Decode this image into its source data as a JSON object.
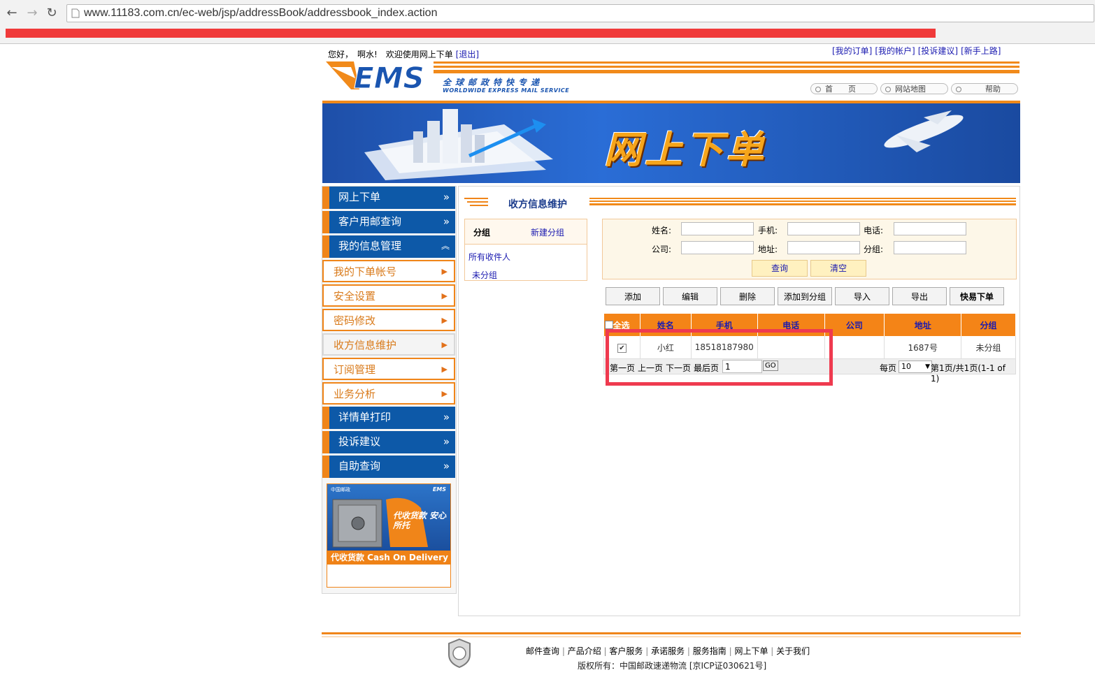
{
  "browser": {
    "url": "www.11183.com.cn/ec-web/jsp/addressBook/addressbook_index.action"
  },
  "header": {
    "greeting": "您好，　啊水!　欢迎使用网上下单",
    "logout": "[退出]",
    "top_links": [
      "[我的订单]",
      "[我的帐户]",
      "[投诉建议]",
      "[新手上路]"
    ],
    "logo_text": "EMS",
    "tagline_cn": "全球邮政特快专递",
    "tagline_en": "WORLDWIDE EXPRESS MAIL SERVICE",
    "nav_pills": [
      "首　　页",
      "网站地图",
      "帮助"
    ]
  },
  "banner": {
    "title": "网上下单"
  },
  "sidebar": {
    "items": [
      {
        "label": "网上下单",
        "style": "blue",
        "arrow": "»"
      },
      {
        "label": "客户用邮查询",
        "style": "blue",
        "arrow": "»"
      },
      {
        "label": "我的信息管理",
        "style": "blue",
        "arrow": "︽"
      },
      {
        "label": "我的下单帐号",
        "style": "white",
        "arrow": "▶"
      },
      {
        "label": "安全设置",
        "style": "white",
        "arrow": "▶"
      },
      {
        "label": "密码修改",
        "style": "white",
        "arrow": "▶"
      },
      {
        "label": "收方信息维护",
        "style": "active",
        "arrow": "▶"
      },
      {
        "label": "订阅管理",
        "style": "white",
        "arrow": "▶"
      },
      {
        "label": "业务分析",
        "style": "white",
        "arrow": "▶"
      },
      {
        "label": "详情单打印",
        "style": "blue",
        "arrow": "»"
      },
      {
        "label": "投诉建议",
        "style": "blue",
        "arrow": "»"
      },
      {
        "label": "自助查询",
        "style": "blue",
        "arrow": "»"
      }
    ],
    "ad": {
      "text": "代收货款 Cash On Delivery",
      "slogan": "代收货款 安心所托",
      "brand": "中国邮政",
      "brand_ems": "EMS"
    }
  },
  "main": {
    "title": "收方信息维护",
    "groups": {
      "header": "分组",
      "new_group": "新建分组",
      "items": [
        "所有收件人",
        "未分组"
      ]
    },
    "search": {
      "name_label": "姓名:",
      "mobile_label": "手机:",
      "phone_label": "电话:",
      "company_label": "公司:",
      "address_label": "地址:",
      "group_label": "分组:",
      "name_value": "",
      "mobile_value": "",
      "phone_value": "",
      "company_value": "",
      "address_value": "",
      "group_value": "",
      "query_button": "查询",
      "clear_button": "清空"
    },
    "toolbar": [
      "添加",
      "编辑",
      "删除",
      "添加到分组",
      "导入",
      "导出",
      "快易下单"
    ],
    "table": {
      "select_all": "全选",
      "columns": [
        "姓名",
        "手机",
        "电话",
        "公司",
        "地址",
        "分组"
      ],
      "rows": [
        {
          "checked": true,
          "name": "小红",
          "mobile": "18518187980",
          "phone": "",
          "company": "",
          "address": "1687号",
          "group": "未分组"
        }
      ]
    },
    "pager": {
      "first": "第一页",
      "prev": "上一页",
      "next": "下一页",
      "last": "最后页",
      "page_input": "1",
      "go": "GO",
      "per_page_label": "每页",
      "per_page_value": "10",
      "summary": "第1页/共1页(1-1 of 1)"
    }
  },
  "footer": {
    "links": [
      "邮件查询",
      "产品介绍",
      "客户服务",
      "承诺服务",
      "服务指南",
      "网上下单",
      "关于我们"
    ],
    "copyright": "版权所有：中国邮政速递物流 [京ICP证030621号]"
  },
  "colors": {
    "orange": "#f08519",
    "blue": "#0d59a8",
    "highlight_red": "#ef3a4f"
  }
}
